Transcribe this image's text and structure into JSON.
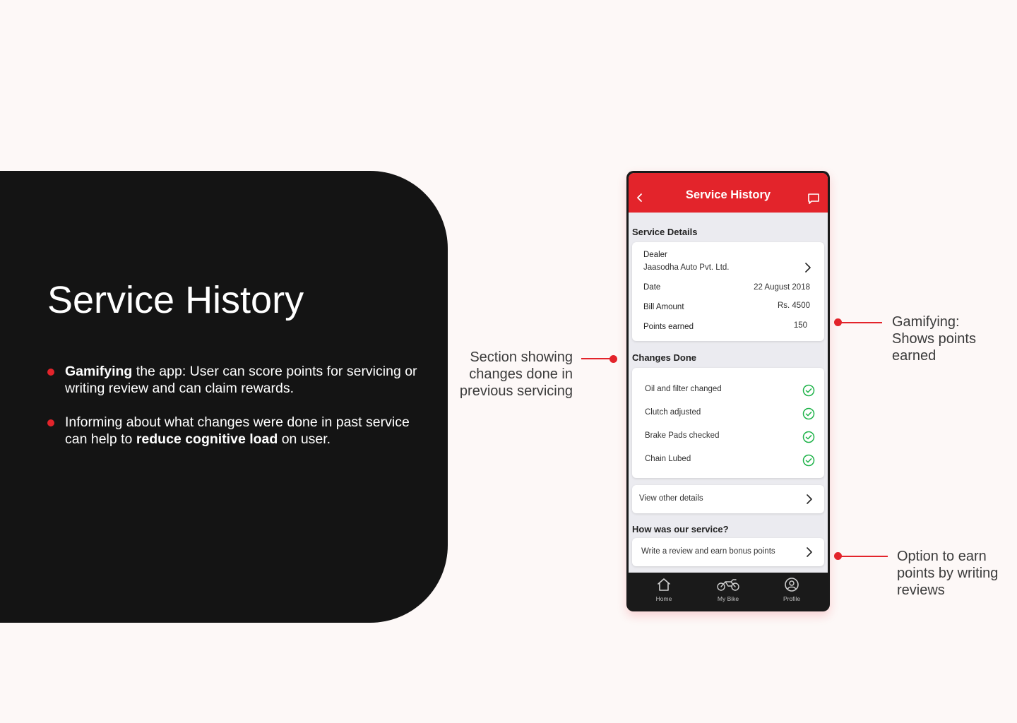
{
  "slide": {
    "title": "Service History",
    "bullets": [
      {
        "bold": "Gamifying",
        "rest": " the app: User can score points for servicing or writing review and can claim rewards."
      },
      {
        "pre": "Informing about what changes were done in  past service can help to ",
        "bold": "reduce cognitive load",
        "post": " on user."
      }
    ]
  },
  "annotations": {
    "changes_section": "Section showing changes done in previous servicing",
    "points_earned": "Gamifying: Shows points earned",
    "review_option": "Option to earn points by writing reviews"
  },
  "app": {
    "title": "Service History",
    "service_details": {
      "heading": "Service Details",
      "dealer_label": "Dealer",
      "dealer_value": "Jaasodha Auto Pvt. Ltd.",
      "date_label": "Date",
      "date_value": "22 August 2018",
      "bill_label": "Bill Amount",
      "bill_value": "Rs. 4500",
      "points_label": "Points earned",
      "points_value": "150"
    },
    "changes_done": {
      "heading": "Changes Done",
      "items": [
        "Oil and filter changed",
        "Clutch adjusted",
        "Brake Pads checked",
        "Chain Lubed"
      ]
    },
    "view_other_details": "View other details",
    "feedback": {
      "heading": "How was our service?",
      "action": "Write a review and earn bonus points"
    },
    "tabs": [
      "Home",
      "My Bike",
      "Profile"
    ]
  },
  "colors": {
    "accent": "#e3242b",
    "panel": "#141414",
    "background": "#fdf8f7",
    "check": "#1fb34a"
  },
  "icons": [
    "back-icon",
    "chat-icon",
    "chevron-right-icon",
    "check-circle-icon",
    "home-icon",
    "motorbike-icon",
    "profile-icon"
  ]
}
